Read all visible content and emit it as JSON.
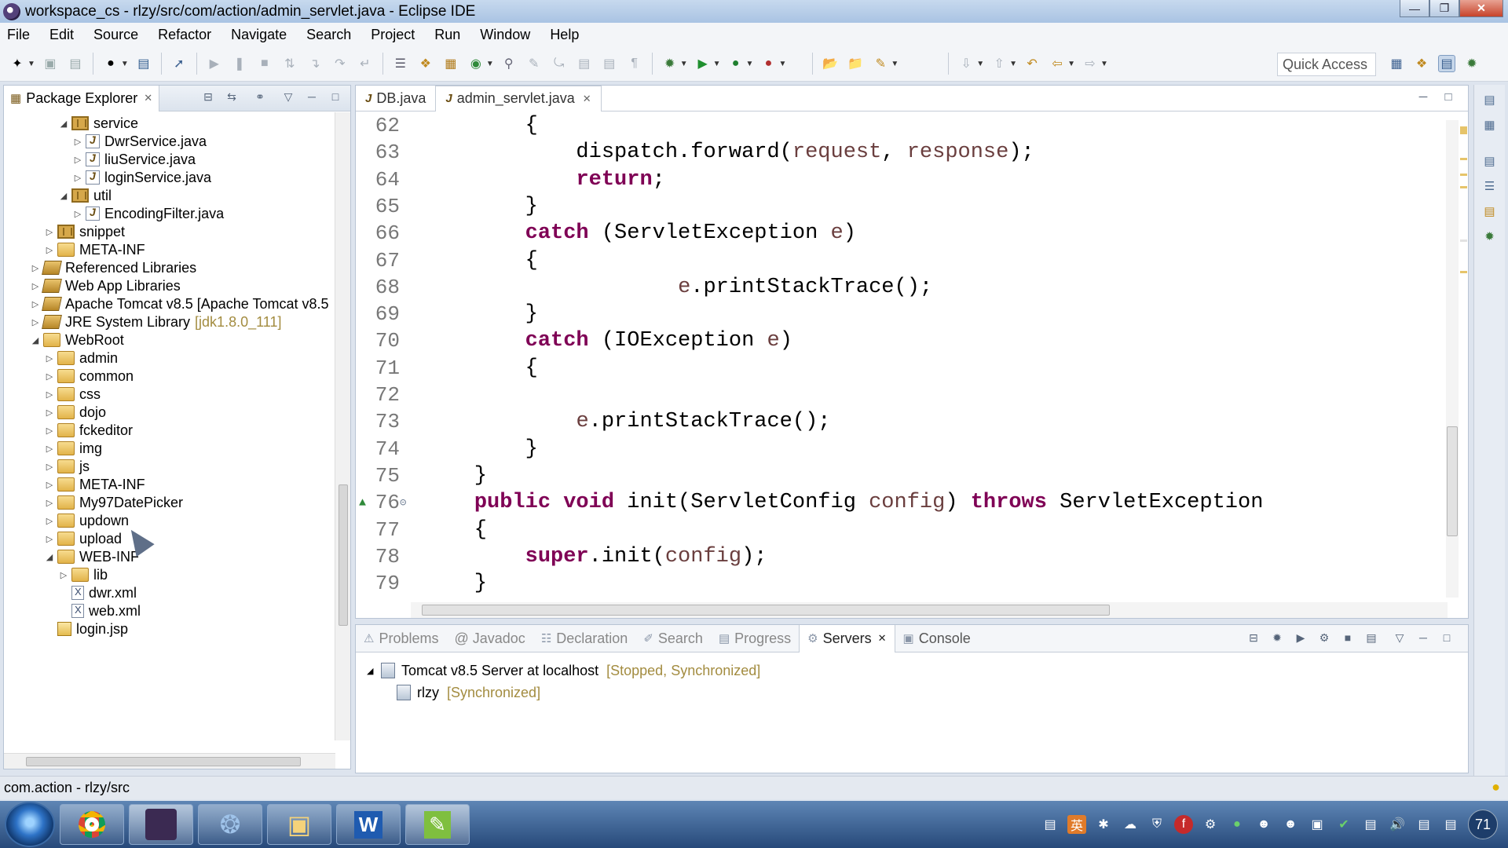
{
  "window": {
    "title": "workspace_cs - rlzy/src/com/action/admin_servlet.java - Eclipse IDE"
  },
  "menu": [
    "File",
    "Edit",
    "Source",
    "Refactor",
    "Navigate",
    "Search",
    "Project",
    "Run",
    "Window",
    "Help"
  ],
  "toolbar": {
    "quick_access": "Quick Access"
  },
  "package_explorer": {
    "title": "Package Explorer",
    "tree": [
      {
        "label": "service",
        "icon": "package-icon",
        "indent": 3,
        "expanded": true
      },
      {
        "label": "DwrService.java",
        "icon": "java-file-icon",
        "indent": 4,
        "expanded": false
      },
      {
        "label": "liuService.java",
        "icon": "java-file-icon",
        "indent": 4,
        "expanded": false
      },
      {
        "label": "loginService.java",
        "icon": "java-file-icon",
        "indent": 4,
        "expanded": false
      },
      {
        "label": "util",
        "icon": "package-icon",
        "indent": 3,
        "expanded": true
      },
      {
        "label": "EncodingFilter.java",
        "icon": "java-file-icon",
        "indent": 4,
        "expanded": false
      },
      {
        "label": "snippet",
        "icon": "package-icon",
        "indent": 2,
        "expanded": false
      },
      {
        "label": "META-INF",
        "icon": "folder-icon",
        "indent": 2,
        "expanded": false
      },
      {
        "label": "Referenced Libraries",
        "icon": "library-icon",
        "indent": 1,
        "expanded": false
      },
      {
        "label": "Web App Libraries",
        "icon": "library-icon",
        "indent": 1,
        "expanded": false
      },
      {
        "label": "Apache Tomcat v8.5 [Apache Tomcat v8.5",
        "icon": "library-icon",
        "indent": 1,
        "expanded": false
      },
      {
        "label": "JRE System Library",
        "decor": "[jdk1.8.0_111]",
        "icon": "library-icon",
        "indent": 1,
        "expanded": false
      },
      {
        "label": "WebRoot",
        "icon": "folder-icon",
        "indent": 1,
        "expanded": true
      },
      {
        "label": "admin",
        "icon": "folder-icon",
        "indent": 2,
        "expanded": false
      },
      {
        "label": "common",
        "icon": "folder-icon",
        "indent": 2,
        "expanded": false
      },
      {
        "label": "css",
        "icon": "folder-icon",
        "indent": 2,
        "expanded": false
      },
      {
        "label": "dojo",
        "icon": "folder-icon",
        "indent": 2,
        "expanded": false
      },
      {
        "label": "fckeditor",
        "icon": "folder-icon",
        "indent": 2,
        "expanded": false
      },
      {
        "label": "img",
        "icon": "folder-icon",
        "indent": 2,
        "expanded": false
      },
      {
        "label": "js",
        "icon": "folder-icon",
        "indent": 2,
        "expanded": false
      },
      {
        "label": "META-INF",
        "icon": "folder-icon",
        "indent": 2,
        "expanded": false
      },
      {
        "label": "My97DatePicker",
        "icon": "folder-icon",
        "indent": 2,
        "expanded": false
      },
      {
        "label": "updown",
        "icon": "folder-icon",
        "indent": 2,
        "expanded": false
      },
      {
        "label": "upload",
        "icon": "folder-icon",
        "indent": 2,
        "expanded": false
      },
      {
        "label": "WEB-INF",
        "icon": "folder-icon",
        "indent": 2,
        "expanded": true
      },
      {
        "label": "lib",
        "icon": "folder-icon",
        "indent": 3,
        "expanded": false
      },
      {
        "label": "dwr.xml",
        "icon": "xml-file-icon",
        "indent": 3,
        "expanded": null
      },
      {
        "label": "web.xml",
        "icon": "xml-file-icon",
        "indent": 3,
        "expanded": null
      },
      {
        "label": "login.jsp",
        "icon": "jsp-file-icon",
        "indent": 2,
        "expanded": null
      }
    ]
  },
  "editor": {
    "tabs": [
      {
        "label": "DB.java",
        "active": false
      },
      {
        "label": "admin_servlet.java",
        "active": true
      }
    ],
    "lines": [
      {
        "n": "62",
        "segs": [
          [
            "",
            "        {"
          ]
        ]
      },
      {
        "n": "63",
        "segs": [
          [
            "",
            "            dispatch.forward("
          ],
          [
            "var",
            "request"
          ],
          [
            "",
            ", "
          ],
          [
            "var",
            "response"
          ],
          [
            "",
            ");"
          ]
        ]
      },
      {
        "n": "64",
        "segs": [
          [
            "",
            "            "
          ],
          [
            "kw",
            "return"
          ],
          [
            "",
            ";"
          ]
        ]
      },
      {
        "n": "65",
        "segs": [
          [
            "",
            "        }"
          ]
        ]
      },
      {
        "n": "66",
        "segs": [
          [
            "",
            "        "
          ],
          [
            "kw",
            "catch"
          ],
          [
            "",
            " (ServletException "
          ],
          [
            "var",
            "e"
          ],
          [
            "",
            ")"
          ]
        ]
      },
      {
        "n": "67",
        "segs": [
          [
            "",
            "        {"
          ]
        ]
      },
      {
        "n": "68",
        "segs": [
          [
            "",
            "                    "
          ],
          [
            "var",
            "e"
          ],
          [
            "",
            ".printStackTrace();"
          ]
        ]
      },
      {
        "n": "69",
        "segs": [
          [
            "",
            "        }"
          ]
        ]
      },
      {
        "n": "70",
        "segs": [
          [
            "",
            "        "
          ],
          [
            "kw",
            "catch"
          ],
          [
            "",
            " (IOException "
          ],
          [
            "var",
            "e"
          ],
          [
            "",
            ")"
          ]
        ]
      },
      {
        "n": "71",
        "segs": [
          [
            "",
            "        {"
          ]
        ]
      },
      {
        "n": "72",
        "segs": [
          [
            "",
            ""
          ]
        ]
      },
      {
        "n": "73",
        "segs": [
          [
            "",
            "            "
          ],
          [
            "var",
            "e"
          ],
          [
            "",
            ".printStackTrace();"
          ]
        ]
      },
      {
        "n": "74",
        "segs": [
          [
            "",
            "        }"
          ]
        ]
      },
      {
        "n": "75",
        "segs": [
          [
            "",
            "    }"
          ]
        ]
      },
      {
        "n": "76",
        "segs": [
          [
            "",
            "    "
          ],
          [
            "kw",
            "public"
          ],
          [
            "",
            " "
          ],
          [
            "kw",
            "void"
          ],
          [
            "",
            " init(ServletConfig "
          ],
          [
            "var",
            "config"
          ],
          [
            "",
            ") "
          ],
          [
            "kw",
            "throws"
          ],
          [
            "",
            " ServletException"
          ]
        ],
        "override": true
      },
      {
        "n": "77",
        "segs": [
          [
            "",
            "    {"
          ]
        ]
      },
      {
        "n": "78",
        "segs": [
          [
            "",
            "        "
          ],
          [
            "kw",
            "super"
          ],
          [
            "",
            ".init("
          ],
          [
            "var",
            "config"
          ],
          [
            "",
            ");"
          ]
        ]
      },
      {
        "n": "79",
        "segs": [
          [
            "",
            "    }"
          ]
        ]
      }
    ]
  },
  "bottom_panel": {
    "tabs": [
      {
        "label": "Problems",
        "active": false
      },
      {
        "label": "@ Javadoc",
        "active": false
      },
      {
        "label": "Declaration",
        "active": false
      },
      {
        "label": "Search",
        "active": false
      },
      {
        "label": "Progress",
        "active": false
      },
      {
        "label": "Servers",
        "active": true
      },
      {
        "label": "Console",
        "active": false
      }
    ],
    "servers": [
      {
        "label": "Tomcat v8.5 Server at localhost",
        "status": "[Stopped, Synchronized]",
        "indent": 0
      },
      {
        "label": "rlzy",
        "status": "[Synchronized]",
        "indent": 1
      }
    ]
  },
  "statusbar": {
    "text": "com.action - rlzy/src"
  },
  "taskbar": {
    "apps": [
      "chrome",
      "eclipse",
      "shark",
      "explorer",
      "word",
      "notepad"
    ],
    "clock": "71"
  }
}
